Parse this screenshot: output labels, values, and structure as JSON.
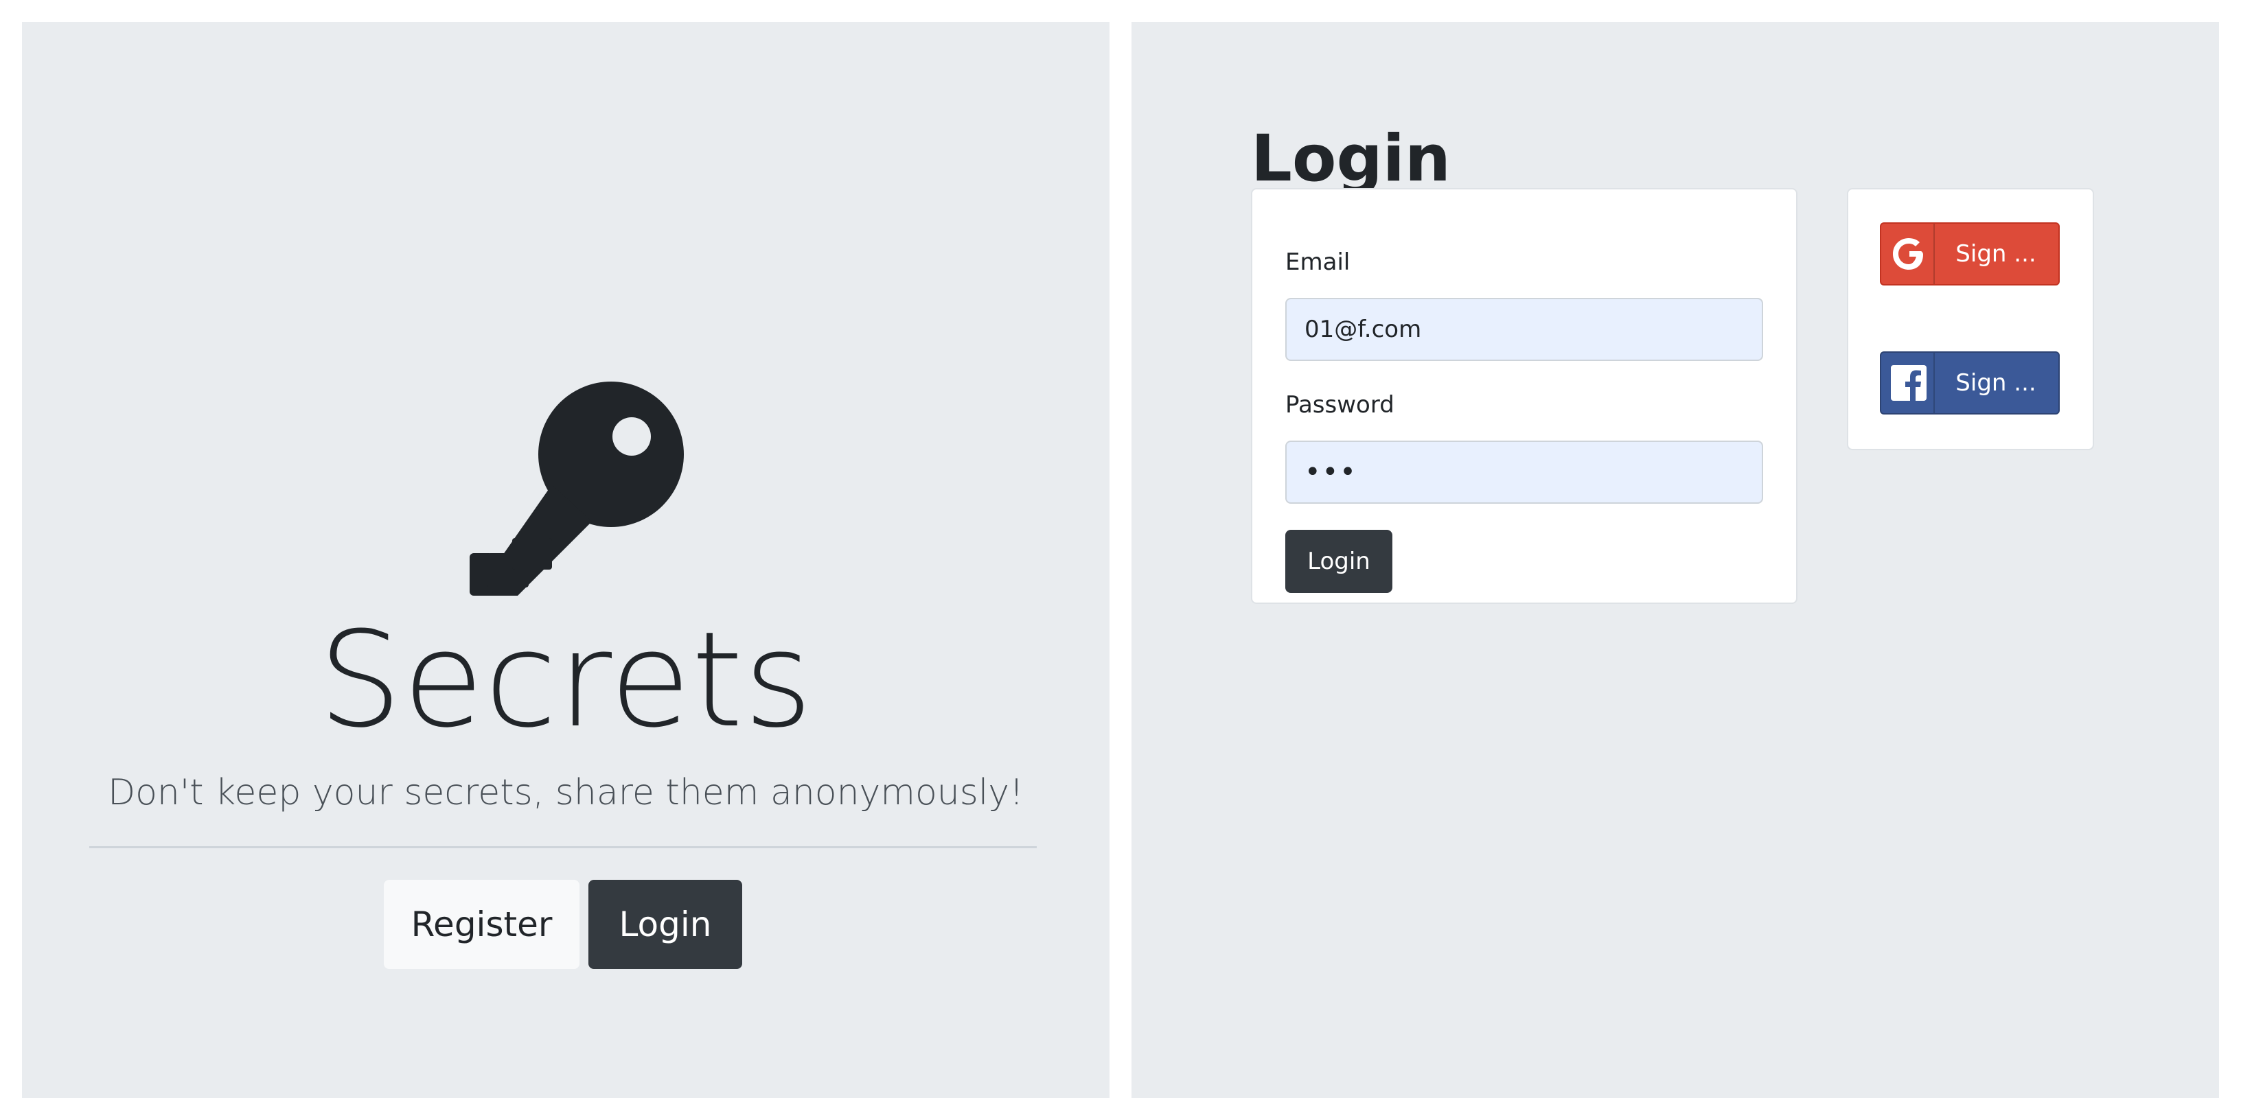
{
  "home": {
    "title": "Secrets",
    "tagline": "Don't keep your secrets, share them anonymously!",
    "register_label": "Register",
    "login_label": "Login",
    "icon": "key-icon"
  },
  "login_page": {
    "heading": "Login",
    "email_label": "Email",
    "email_value": "01@f.com",
    "password_label": "Password",
    "password_value": "•••",
    "submit_label": "Login",
    "google_label": "Sign ...",
    "facebook_label": "Sign ...",
    "google_icon": "google-icon",
    "facebook_icon": "facebook-icon"
  },
  "colors": {
    "panel_background": "#e9ecef",
    "dark_button": "#343a40",
    "light_button": "#f8f9fa",
    "google_red": "#dd4b39",
    "facebook_blue": "#3b5998",
    "input_autofill": "#e8f0fe"
  }
}
